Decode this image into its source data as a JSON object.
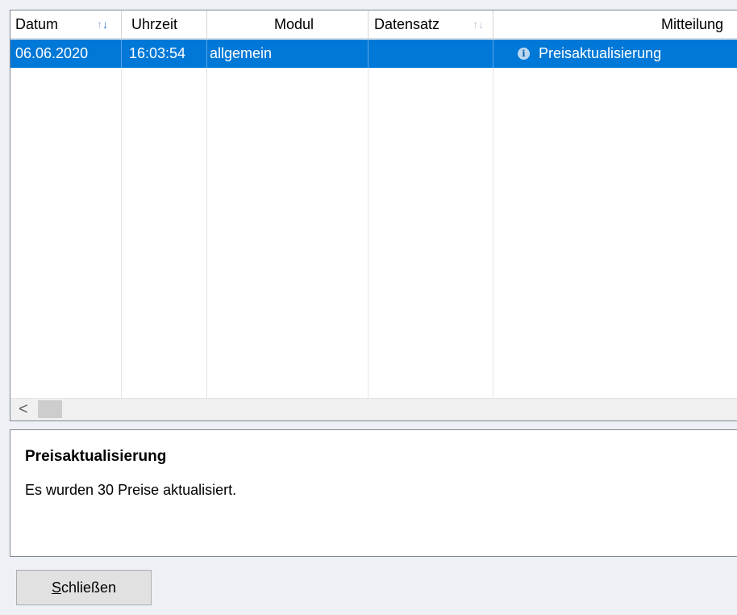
{
  "table": {
    "columns": [
      {
        "label": "Datum",
        "sort": "desc"
      },
      {
        "label": "Uhrzeit"
      },
      {
        "label": "Modul"
      },
      {
        "label": "Datensatz",
        "sort": "none"
      },
      {
        "label": "Mitteilung"
      }
    ],
    "rows": [
      {
        "datum": "06.06.2020",
        "uhrzeit": "16:03:54",
        "modul": "allgemein",
        "datensatz": "",
        "icon": "info-icon",
        "mitteilung": "Preisaktualisierung"
      }
    ],
    "selected_row_color": "#0078d7",
    "scroll_left_glyph": "<"
  },
  "detail": {
    "title": "Preisaktualisierung",
    "message": "Es wurden 30 Preise aktualisiert."
  },
  "close_button": {
    "accel": "S",
    "rest": "chließen"
  }
}
